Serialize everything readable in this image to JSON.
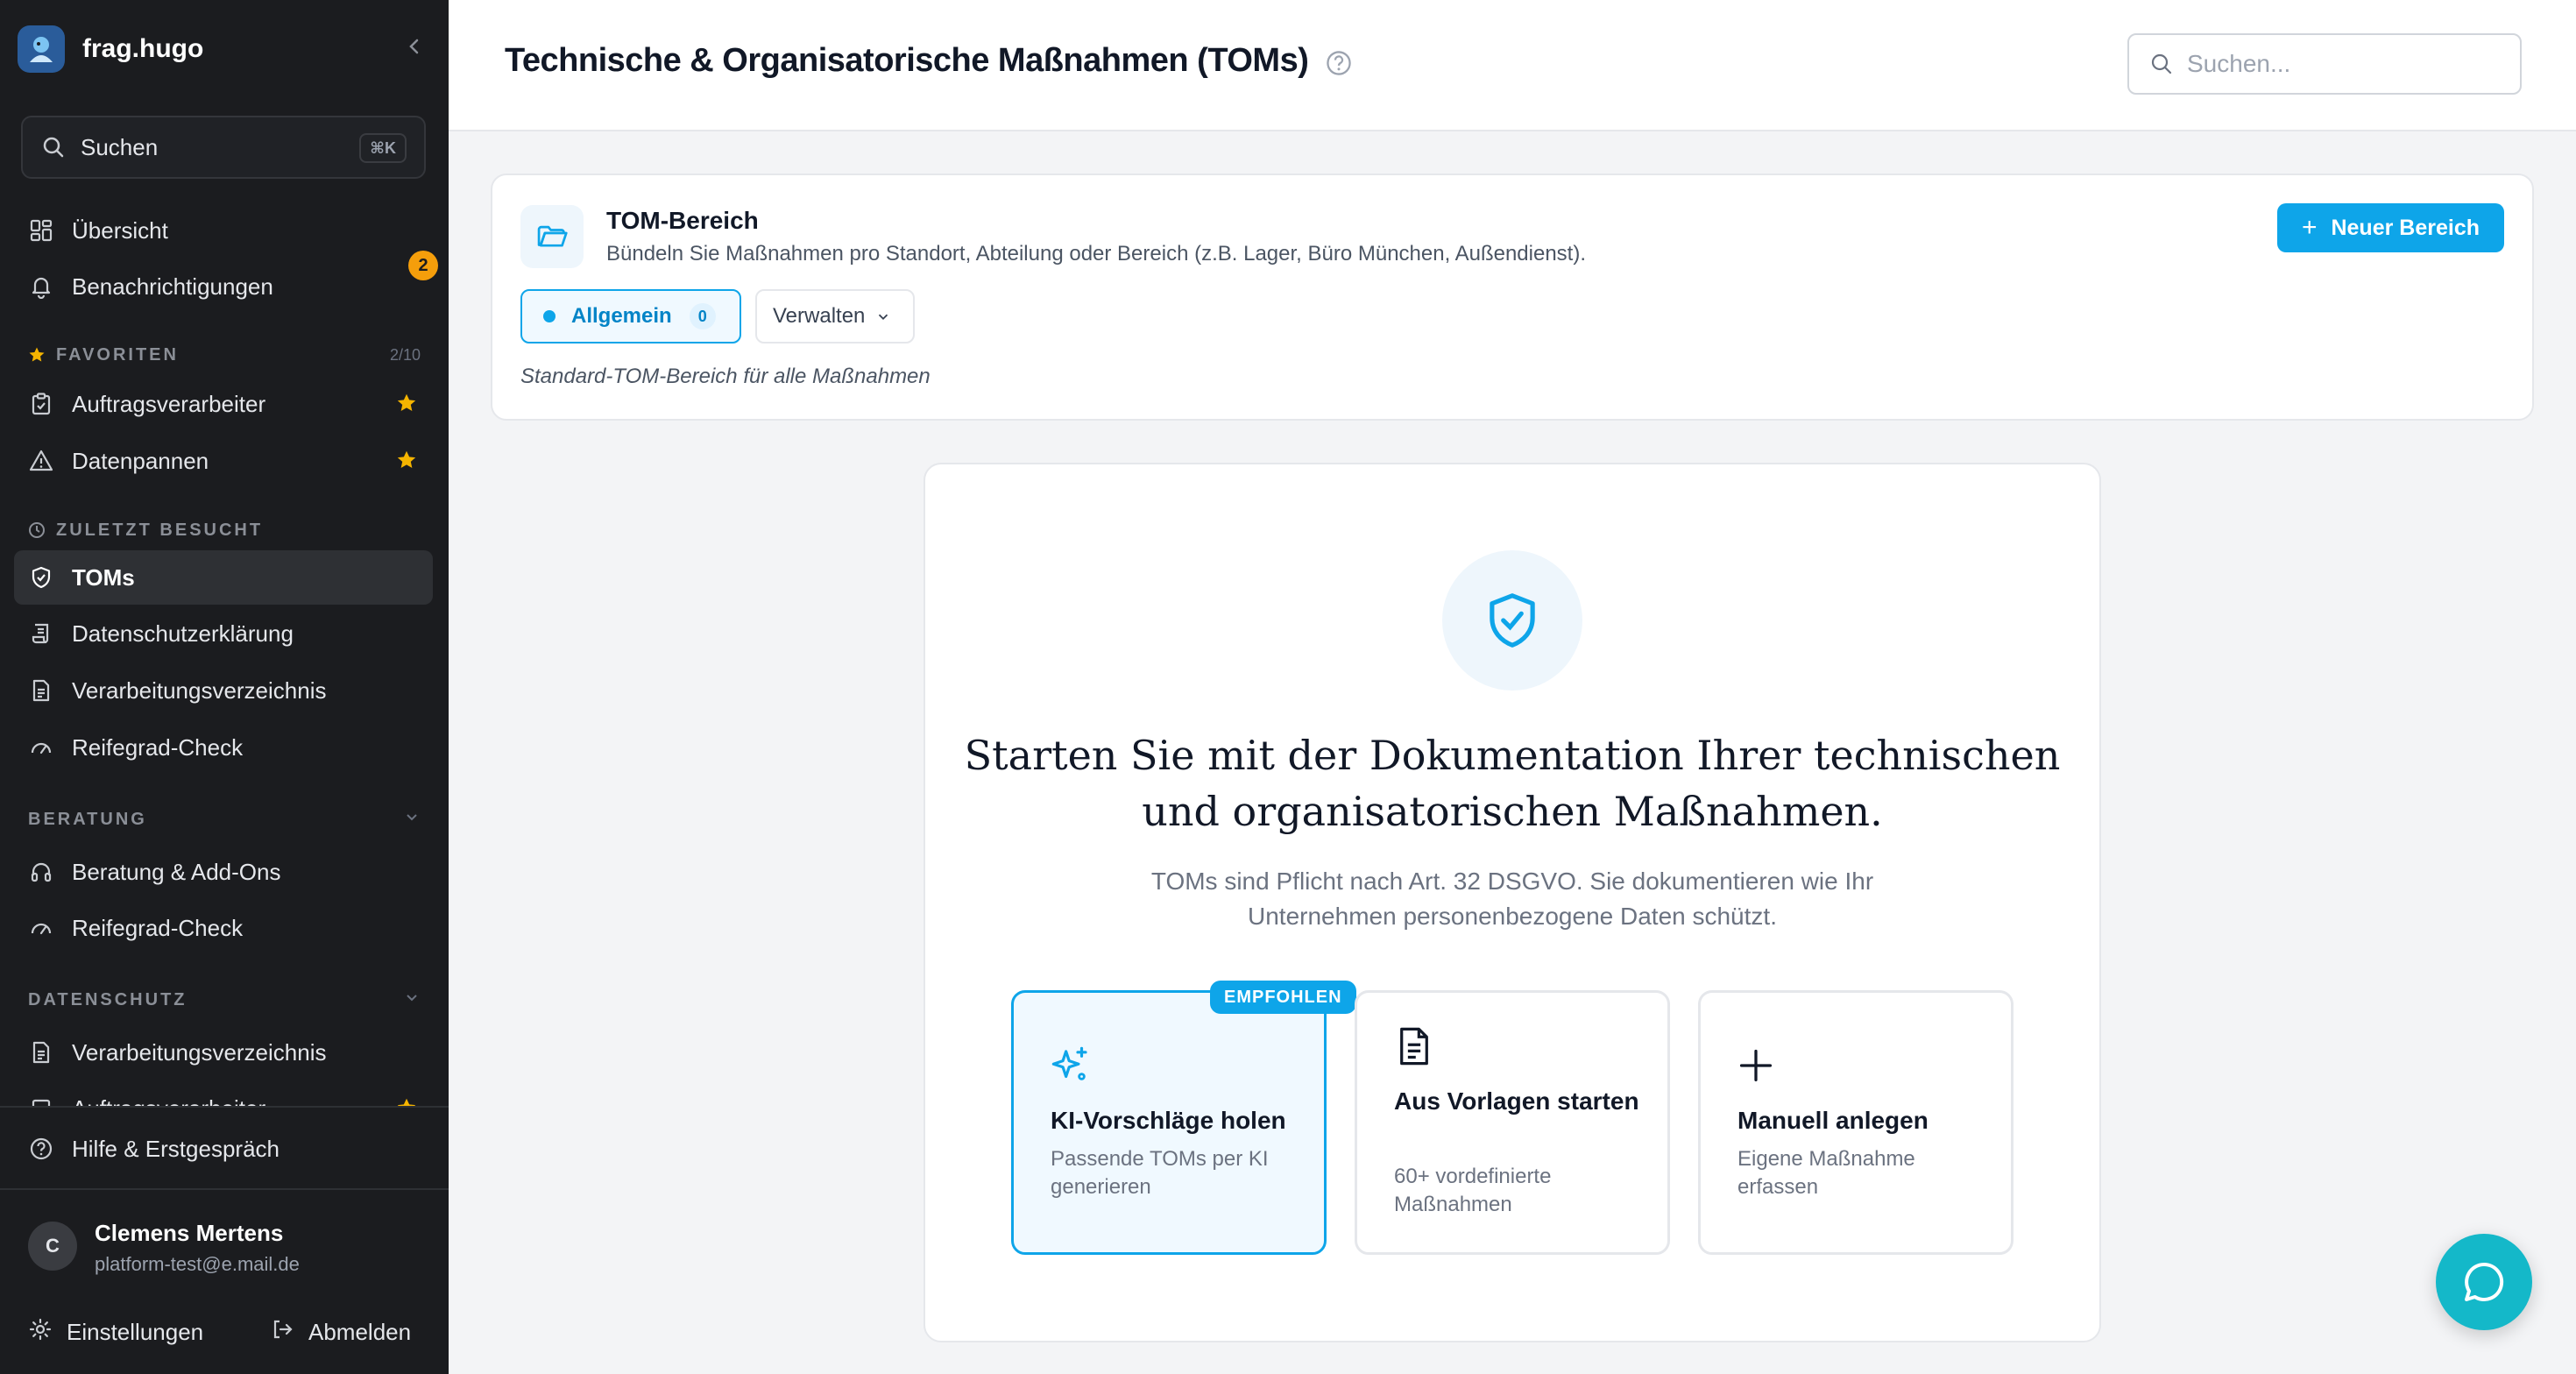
{
  "brand": {
    "name": "frag.hugo"
  },
  "sidebar": {
    "search": {
      "label": "Suchen",
      "shortcut": "⌘K"
    },
    "main": [
      {
        "label": "Übersicht"
      },
      {
        "label": "Benachrichtigungen",
        "badge": "2"
      }
    ],
    "favorites": {
      "title": "FAVORITEN",
      "count": "2/10",
      "items": [
        {
          "label": "Auftragsverarbeiter"
        },
        {
          "label": "Datenpannen"
        }
      ]
    },
    "recent": {
      "title": "ZULETZT BESUCHT",
      "items": [
        {
          "label": "TOMs",
          "active": true
        },
        {
          "label": "Datenschutzerklärung"
        },
        {
          "label": "Verarbeitungsverzeichnis"
        },
        {
          "label": "Reifegrad-Check"
        }
      ]
    },
    "beratung": {
      "title": "BERATUNG",
      "items": [
        {
          "label": "Beratung & Add-Ons"
        },
        {
          "label": "Reifegrad-Check"
        }
      ]
    },
    "datenschutz": {
      "title": "DATENSCHUTZ",
      "items": [
        {
          "label": "Verarbeitungsverzeichnis"
        },
        {
          "label": "Auftragsverarbeiter"
        }
      ]
    },
    "help": {
      "label": "Hilfe & Erstgespräch"
    },
    "user": {
      "initial": "C",
      "name": "Clemens Mertens",
      "email": "platform-test@e.mail.de"
    },
    "footer": {
      "settings": "Einstellungen",
      "logout": "Abmelden"
    }
  },
  "header": {
    "title": "Technische & Organisatorische Maßnahmen (TOMs)",
    "search_placeholder": "Suchen..."
  },
  "area": {
    "title": "TOM-Bereich",
    "description": "Bündeln Sie Maßnahmen pro Standort, Abteilung oder Bereich (z.B. Lager, Büro München, Außendienst).",
    "new_button": "Neuer Bereich",
    "chip_label": "Allgemein",
    "chip_count": "0",
    "manage_label": "Verwalten",
    "note": "Standard-TOM-Bereich für alle Maßnahmen"
  },
  "empty": {
    "title_line1": "Starten Sie mit der Dokumentation Ihrer technischen",
    "title_line2": "und organisatorischen Maßnahmen.",
    "desc_line1": "TOMs sind Pflicht nach Art. 32 DSGVO. Sie dokumentieren wie Ihr",
    "desc_line2": "Unternehmen personenbezogene Daten schützt.",
    "options": [
      {
        "badge": "EMPFOHLEN",
        "title": "KI-Vorschläge holen",
        "desc": "Passende TOMs per KI generieren",
        "icon": "sparkles-icon"
      },
      {
        "title": "Aus Vorlagen starten",
        "desc": "60+ vordefinierte Maßnahmen",
        "icon": "document-icon"
      },
      {
        "title": "Manuell anlegen",
        "desc": "Eigene Maßnahme erfassen",
        "icon": "plus-icon"
      }
    ]
  },
  "colors": {
    "accent": "#0ea5e9",
    "sidebar_bg": "#1b1c1f",
    "star": "#f5b400",
    "badge": "#f59e0b",
    "chat": "#14b8c9"
  }
}
